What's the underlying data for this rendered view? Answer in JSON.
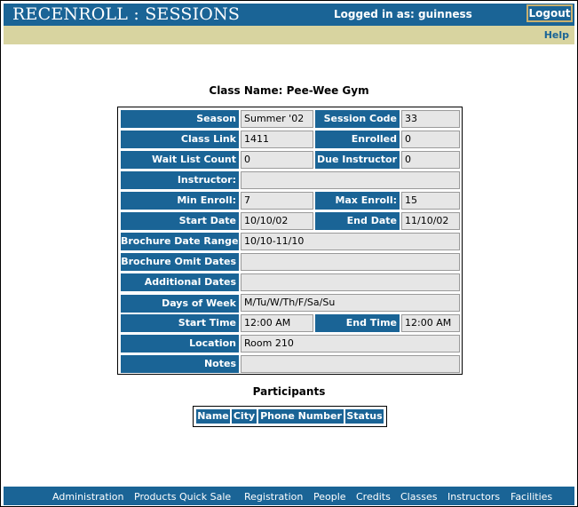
{
  "header": {
    "app_title": "RECENROLL : SESSIONS",
    "logged_in": "Logged in as: guinness",
    "logout_label": "Logout",
    "help_label": "Help"
  },
  "class_name": "Class Name: Pee-Wee Gym",
  "details": {
    "season_label": "Season",
    "season": "Summer '02",
    "session_code_label": "Session Code",
    "session_code": "33",
    "class_link_label": "Class Link",
    "class_link": "1411",
    "enrolled_label": "Enrolled",
    "enrolled": "0",
    "wait_list_label": "Wait List Count",
    "wait_list": "0",
    "due_instructor_label": "Due Instructor",
    "due_instructor": "0",
    "instructor_label": "Instructor:",
    "instructor": "",
    "min_enroll_label": "Min Enroll:",
    "min_enroll": "7",
    "max_enroll_label": "Max Enroll:",
    "max_enroll": "15",
    "start_date_label": "Start Date",
    "start_date": "10/10/02",
    "end_date_label": "End Date",
    "end_date": "11/10/02",
    "brochure_range_label": "Brochure Date Range",
    "brochure_range": "10/10-11/10",
    "brochure_omit_label": "Brochure Omit Dates",
    "brochure_omit": "",
    "additional_dates_label": "Additional Dates",
    "additional_dates": "",
    "days_label": "Days of Week",
    "days": "M/Tu/W/Th/F/Sa/Su",
    "start_time_label": "Start Time",
    "start_time": "12:00 AM",
    "end_time_label": "End Time",
    "end_time": "12:00 AM",
    "location_label": "Location",
    "location": "Room 210",
    "notes_label": "Notes",
    "notes": ""
  },
  "participants": {
    "title": "Participants",
    "columns": [
      "Name",
      "City",
      "Phone Number",
      "Status"
    ]
  },
  "footer_nav": [
    "Administration",
    "Products Quick Sale",
    "Registration",
    "People",
    "Credits",
    "Classes",
    "Instructors",
    "Facilities"
  ],
  "colors": {
    "primary": "#1a6496",
    "help_bar": "#d8d4a0",
    "value_bg": "#e6e6e6"
  }
}
